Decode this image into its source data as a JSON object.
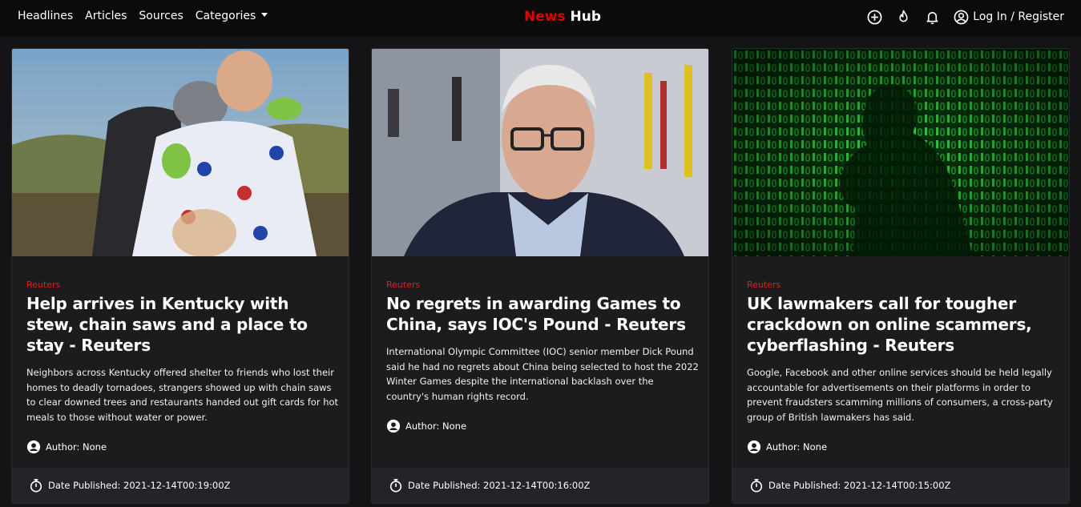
{
  "nav": {
    "links": [
      "Headlines",
      "Articles",
      "Sources",
      "Categories"
    ],
    "brand_red": "News",
    "brand_white": "Hub",
    "login": "Log In / Register",
    "icons": [
      "add-circle-icon",
      "fire-icon",
      "bell-icon",
      "user-circle-icon"
    ]
  },
  "colors": {
    "accent": "#e00000",
    "background": "#141416",
    "card": "#1c1c1f",
    "footer": "#242428"
  },
  "articles": [
    {
      "source": "Reuters",
      "title": "Help arrives in Kentucky with stew, chain saws and a place to stay - Reuters",
      "description": "Neighbors across Kentucky offered shelter to friends who lost their homes to deadly tornadoes, strangers showed up with chain saws to clear downed trees and restaurants handed out gift cards for hot meals to those without water or power.",
      "author": "Author: None",
      "date": "Date Published: 2021-12-14T00:19:00Z",
      "image": "photo of two people embracing outdoors"
    },
    {
      "source": "Reuters",
      "title": "No regrets in awarding Games to China, says IOC's Pound - Reuters",
      "description": "International Olympic Committee (IOC) senior member Dick Pound said he had no regrets about China being selected to host the 2022 Winter Games despite the international backlash over the country's human rights record.",
      "author": "Author: None",
      "date": "Date Published: 2021-12-14T00:16:00Z",
      "image": "portrait of older man with glasses"
    },
    {
      "source": "Reuters",
      "title": "UK lawmakers call for tougher crackdown on online scammers, cyberflashing - Reuters",
      "description": "Google, Facebook and other online services should be held legally accountable for advertisements on their platforms in order to prevent fraudsters scamming millions of consumers, a cross-party group of British lawmakers has said.",
      "author": "Author: None",
      "date": "Date Published: 2021-12-14T00:15:00Z",
      "image": "silhouette over green binary code"
    }
  ]
}
